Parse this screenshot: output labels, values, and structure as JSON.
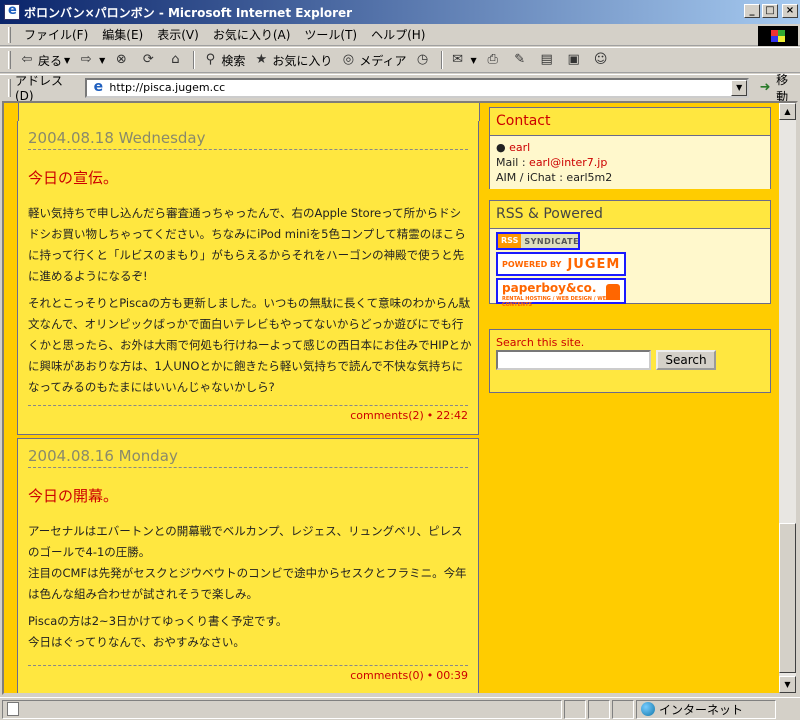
{
  "window": {
    "title": "ボロンバン×パロンボン - Microsoft Internet Explorer",
    "buttons": [
      "_",
      "□",
      "×"
    ]
  },
  "menu": [
    "ファイル(F)",
    "編集(E)",
    "表示(V)",
    "お気に入り(A)",
    "ツール(T)",
    "ヘルプ(H)"
  ],
  "toolbar": {
    "back": "戻る",
    "search": "検索",
    "favorites": "お気に入り",
    "media": "メディア"
  },
  "address": {
    "label": "アドレス(D)",
    "url": "http://pisca.jugem.cc",
    "go": "移動"
  },
  "posts": [
    {
      "date": "2004.08.18 Wednesday",
      "title": "今日の宣伝。",
      "paragraphs": [
        "軽い気持ちで申し込んだら審査通っちゃったんで、右のApple Storeって所からドシドシお買い物しちゃってください。ちなみにiPod miniを5色コンプして精霊のほこらに持って行くと「ルビスのまもり」がもらえるからそれをハーゴンの神殿で使うと先に進めるようになるぞ!",
        "それとこっそりとPiscaの方も更新しました。いつもの無駄に長くて意味のわからん駄文なんで、オリンピックばっかで面白いテレビもやってないからどっか遊びにでも行くかと思ったら、お外は大雨で何処も行けねーよって感じの西日本にお住みでHIPとかに興味があおりな方は、1人UNOとかに飽きたら軽い気持ちで読んで不快な気持ちになってみるのもたまにはいいんじゃないかしら?"
      ],
      "comments": "comments(2)",
      "time": "22:42"
    },
    {
      "date": "2004.08.16 Monday",
      "title": "今日の開幕。",
      "paragraphs": [
        "アーセナルはエバートンとの開幕戦でベルカンプ、レジェス、リュングベリ、ピレスのゴールで4-1の圧勝。\n注目のCMFは先発がセスクとジウベウトのコンビで途中からセスクとフラミニ。今年は色んな組み合わせが試されそうで楽しみ。",
        "Piscaの方は2~3日かけてゆっくり書く予定です。\n今日はぐってりなんで、おやすみなさい。"
      ],
      "comments": "comments(0)",
      "time": "00:39"
    }
  ],
  "contact": {
    "heading": "Contact",
    "name": "earl",
    "mail_label": "Mail :",
    "mail": "earl@inter7.jp",
    "aim": "AIM / iChat : earl5m2"
  },
  "rss": {
    "heading": "RSS & Powered",
    "badge_rss_l": "RSS",
    "badge_rss_r": "SYNDICATE",
    "badge_jugem_l": "POWERED BY",
    "badge_jugem_r": "JUGEM",
    "badge_pb": "paperboy&co.",
    "badge_pb_small": "RENTAL HOSTING / WEB DESIGN / WEB CONTENTS"
  },
  "search": {
    "label": "Search this site.",
    "button": "Search",
    "value": ""
  },
  "status": {
    "zone": "インターネット"
  }
}
